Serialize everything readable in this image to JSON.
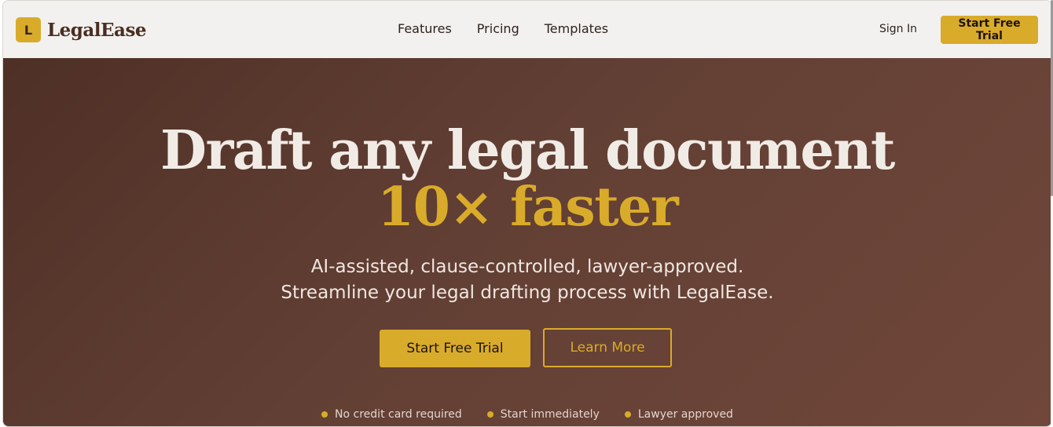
{
  "brand": {
    "logo_letter": "L",
    "name": "LegalEase"
  },
  "nav": {
    "items": [
      {
        "label": "Features"
      },
      {
        "label": "Pricing"
      },
      {
        "label": "Templates"
      }
    ]
  },
  "header": {
    "signin_label": "Sign In",
    "cta_label": "Start Free Trial"
  },
  "hero": {
    "headline": "Draft any legal document",
    "headline_accent": "10× faster",
    "subheading_line1": "AI-assisted, clause-controlled, lawyer-approved.",
    "subheading_line2": "Streamline your legal drafting process with LegalEase.",
    "primary_button": "Start Free Trial",
    "secondary_button": "Learn More",
    "badges": [
      {
        "label": "No credit card required"
      },
      {
        "label": "Start immediately"
      },
      {
        "label": "Lawyer approved"
      }
    ]
  },
  "colors": {
    "accent": "#d9ab2a",
    "header_bg": "#f3f1ef",
    "hero_bg_start": "#4f3026",
    "hero_bg_end": "#70473a",
    "text_dark": "#2d231f",
    "text_light": "#f1ebe6"
  }
}
